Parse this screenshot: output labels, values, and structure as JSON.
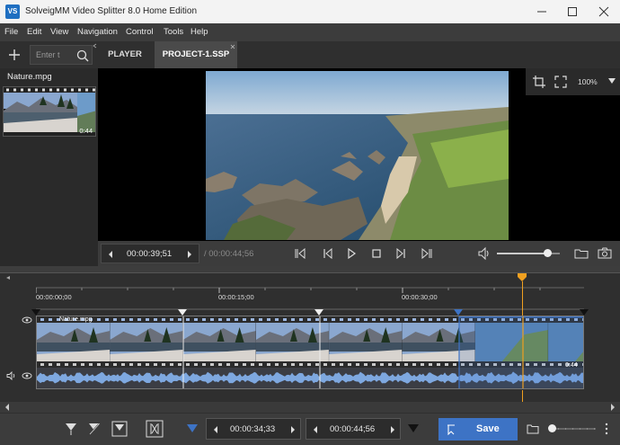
{
  "window": {
    "app_icon": "VS",
    "title": "SolveigMM Video Splitter 8.0 Home Edition",
    "minimize_icon": "minimize-icon",
    "maximize_icon": "maximize-icon",
    "close_icon": "close-icon"
  },
  "menu": [
    "File",
    "Edit",
    "View",
    "Navigation",
    "Control",
    "Tools",
    "Help"
  ],
  "toolbar": {
    "add_icon": "plus-icon",
    "search_placeholder": "Enter t",
    "search_icon": "search-icon"
  },
  "tabs": [
    {
      "label": "PLAYER",
      "active": false
    },
    {
      "label": "PROJECT-1.SSP",
      "active": true
    }
  ],
  "file_list": {
    "file_name": "Nature.mpg",
    "thumbnail_duration": "0:44"
  },
  "view_tools": {
    "zoom": "100%"
  },
  "player": {
    "current_time": "00:00:39;51",
    "total_time": "/ 00:00:44;56",
    "volume_level": 0.8
  },
  "timeline": {
    "ruler_labels": [
      "00:00:00;00",
      "00:00:15;00",
      "00:00:30;00"
    ],
    "clip_name": "Nature.mpg",
    "clip_duration": "0:44"
  },
  "bottom": {
    "start_time": "00:00:34;33",
    "end_time": "00:00:44;56",
    "save_label": "Save",
    "zoom_level": 0.0
  },
  "colors": {
    "accent": "#3d73c5",
    "marker_orange": "#f0a020",
    "waveform": "#7ea8e0"
  }
}
